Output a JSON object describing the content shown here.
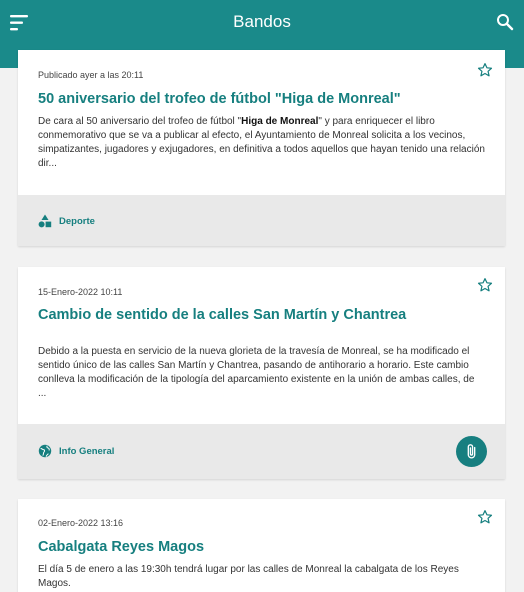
{
  "appbar": {
    "title": "Bandos"
  },
  "colors": {
    "primary": "#1a8a8a",
    "accent_text": "#167f7f",
    "footer_bg": "#e9e9e9"
  },
  "cards": [
    {
      "date": "Publicado ayer a las 20:11",
      "title": "50 aniversario del trofeo de fútbol \"Higa de Monreal\"",
      "body_pre": "De cara al 50 aniversario del trofeo de fútbol \"",
      "body_bold": "Higa de Monreal",
      "body_post": "\" y para enriquecer el libro conmemorativo que se va a publicar al efecto, el Ayuntamiento de Monreal solicita a los vecinos, simpatizantes, jugadores y exjugadores, en definitiva a todos aquellos que hayan tenido una relación dir...",
      "category": "Deporte",
      "category_icon": "shapes-icon"
    },
    {
      "date": "15-Enero-2022 10:11",
      "title": "Cambio de sentido de la calles San Martín y Chantrea",
      "body": "Debido a la puesta en servicio de la nueva glorieta de la travesía de Monreal, se ha modificado el sentido único de las calles San Martín y Chantrea, pasando de antihorario a horario. Este cambio conlleva la modificación de la tipología del aparcamiento existente en la unión de ambas calles, de ...",
      "category": "Info General",
      "category_icon": "globe-icon",
      "attachment_icon": "paperclip-icon"
    },
    {
      "date": "02-Enero-2022 13:16",
      "title": "Cabalgata Reyes Magos",
      "body": "El día 5 de enero a las 19:30h tendrá lugar por las calles de Monreal la cabalgata de los Reyes Magos."
    }
  ]
}
